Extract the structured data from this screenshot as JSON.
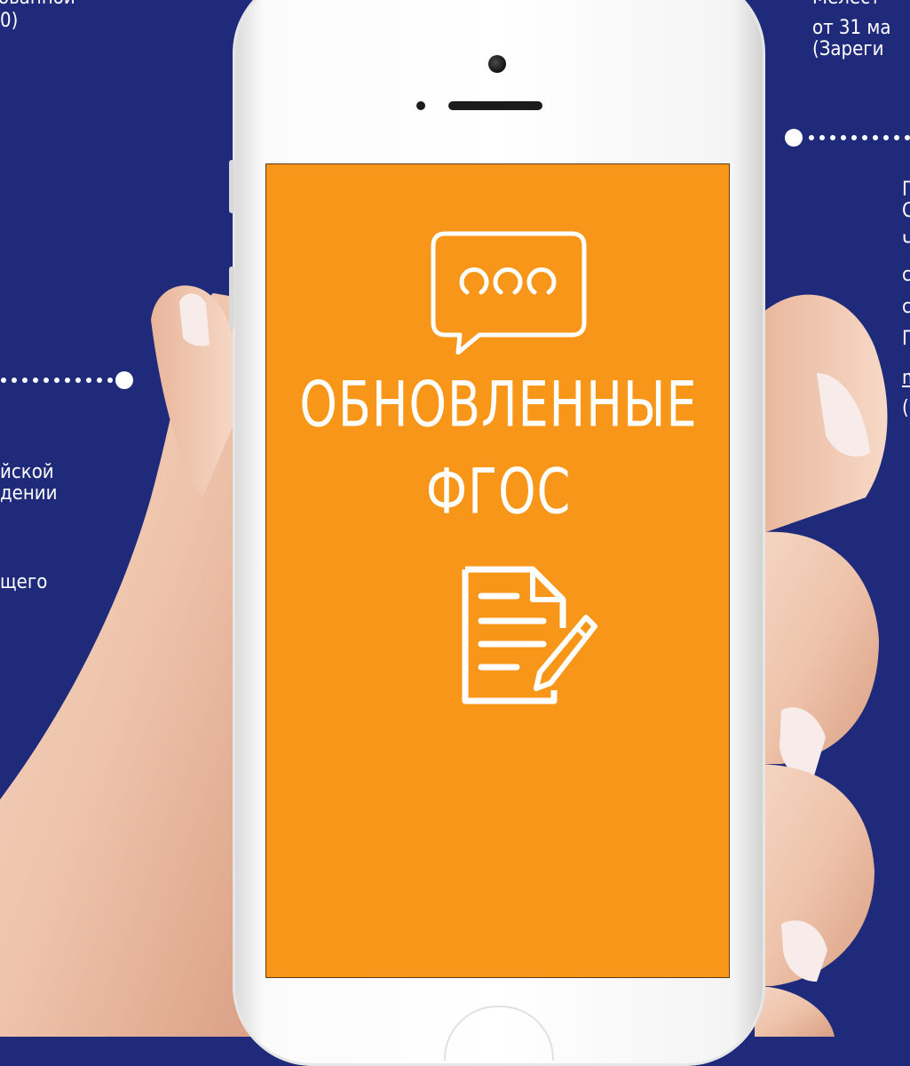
{
  "screen": {
    "title_line1": "ОБНОВЛЕННЫЕ",
    "title_line2": "ФГОС",
    "chat_icon": "chat-bubble-icon",
    "doc_icon": "document-edit-icon",
    "background": "#f79619"
  },
  "left_text": {
    "line0": "ованной",
    "line1": "0)",
    "line2": "йской",
    "line3": "дении",
    "line4": "щего"
  },
  "right_text": {
    "line1": "Мелест",
    "line2": "от 31 ма",
    "line3": "(Зареги",
    "b1": "Г",
    "b2": "С",
    "b3": "Ч",
    "b4": "с",
    "b5": "с",
    "b6": "Г",
    "b7": "m",
    "b8": "("
  },
  "colors": {
    "background": "#1f2a7a",
    "accent": "#f79619",
    "text": "#ffffff"
  }
}
